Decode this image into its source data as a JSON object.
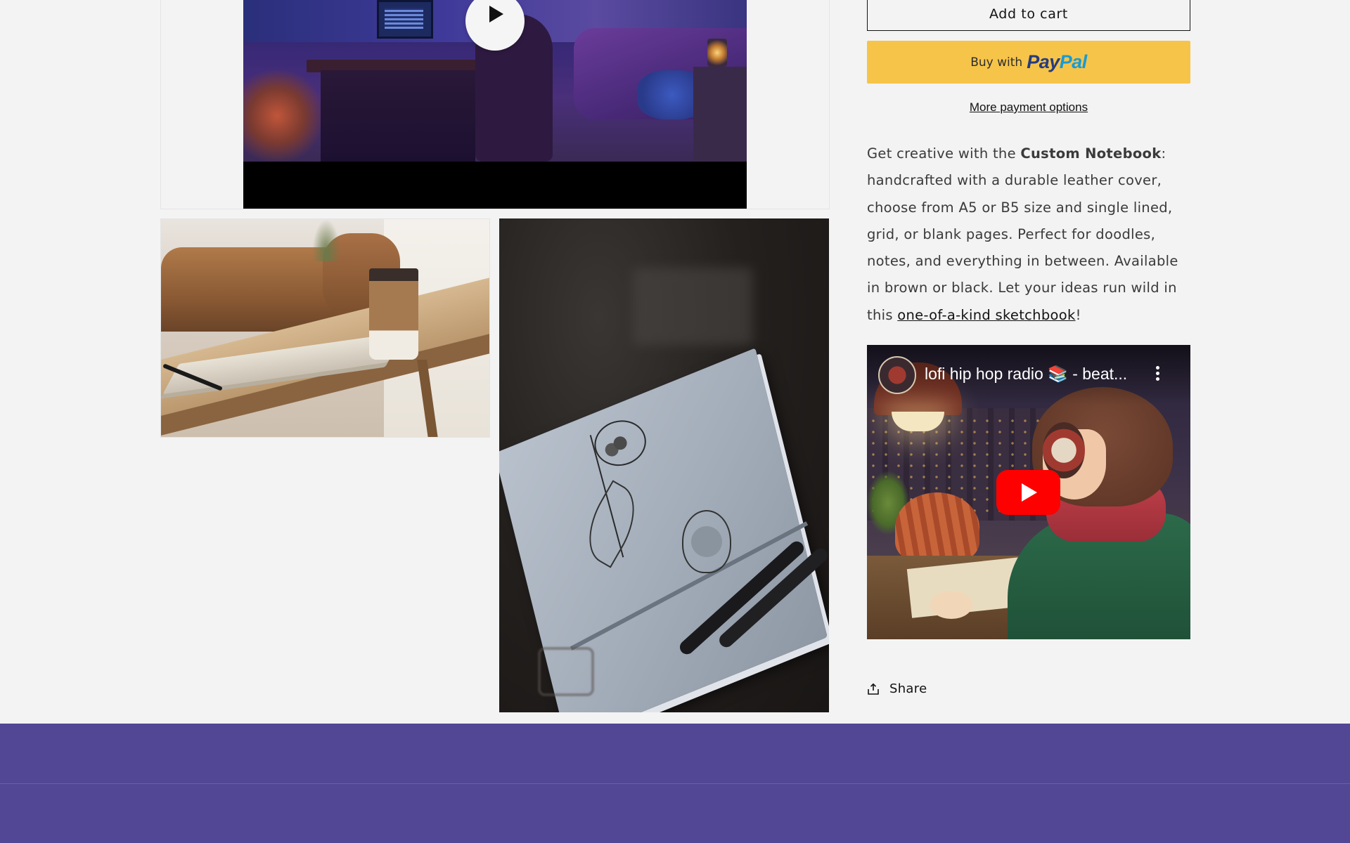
{
  "product": {
    "add_to_cart_label": "Add to cart",
    "paypal_prefix": "Buy with",
    "paypal_brand_pay": "Pay",
    "paypal_brand_pal": "Pal",
    "more_payment_label": "More payment options",
    "description": {
      "intro": "Get creative with the ",
      "product_name": "Custom Notebook",
      "body": ": handcrafted with a durable leather cover, choose from A5 or B5 size and single lined, grid, or blank pages. Perfect for doodles, notes, and everything in between. Available in brown or black. Let your ideas run wild in this ",
      "link_text": "one-of-a-kind sketchbook",
      "outro": "!"
    },
    "share_label": "Share"
  },
  "embed": {
    "video_title": "lofi hip hop radio 📚 - beat..."
  },
  "colors": {
    "page_bg": "#f3f3f3",
    "paypal_yellow": "#f6c449",
    "footer_purple": "#514795",
    "youtube_red": "#ff0000"
  },
  "icons": {
    "gallery_play": "play-icon",
    "youtube_play": "youtube-play-icon",
    "more": "more-vertical-icon",
    "share": "share-icon"
  }
}
